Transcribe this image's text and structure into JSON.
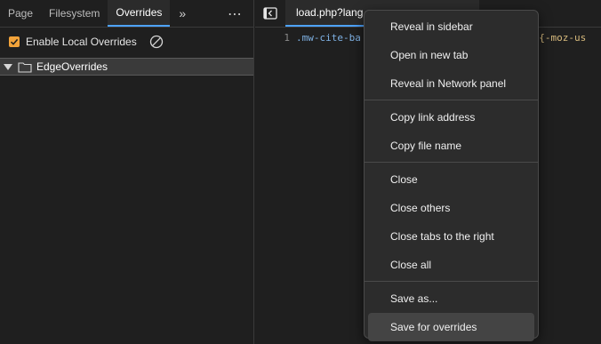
{
  "left_panel": {
    "tabs": [
      "Page",
      "Filesystem",
      "Overrides"
    ],
    "active_tab": "Overrides",
    "more_tabs_glyph": "»",
    "menu_glyph": "⋯",
    "enable_overrides_label": "Enable Local Overrides",
    "enable_overrides_checked": true,
    "folder_name": "EdgeOverrides"
  },
  "editor": {
    "file_tab": "load.php?lang",
    "line_number": "1",
    "code_visible_start": ".mw-cite-ba",
    "code_visible_end": "el{-moz-us"
  },
  "context_menu": {
    "groups": [
      [
        "Reveal in sidebar",
        "Open in new tab",
        "Reveal in Network panel"
      ],
      [
        "Copy link address",
        "Copy file name"
      ],
      [
        "Close",
        "Close others",
        "Close tabs to the right",
        "Close all"
      ],
      [
        "Save as...",
        "Save for overrides"
      ]
    ],
    "highlighted_item": "Save for overrides"
  },
  "colors": {
    "accent": "#4da3ff",
    "checkbox": "#f2a33a",
    "background": "#1f1f1f",
    "menu_background": "#2c2c2c"
  },
  "icons": [
    "more-tabs-icon",
    "kebab-menu-icon",
    "checkbox-check-icon",
    "clear-icon",
    "expand-triangle-icon",
    "folder-icon",
    "sidebar-toggle-icon"
  ]
}
